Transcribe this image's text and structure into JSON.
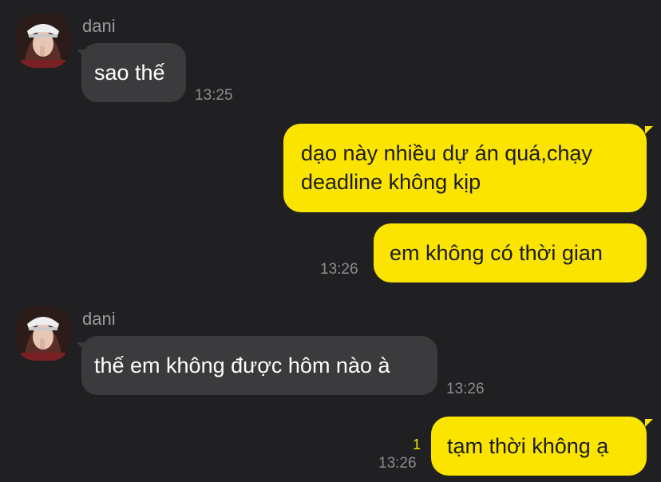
{
  "messages": [
    {
      "sender": "dani",
      "text": "sao thế",
      "time": "13:25"
    },
    {
      "text_line1": "dạo này nhiều dự án quá,chạy",
      "text_line2": "deadline không kịp"
    },
    {
      "text": "em không có thời gian",
      "time": "13:26"
    },
    {
      "sender": "dani",
      "text": "thế em không được hôm nào à",
      "time": "13:26"
    },
    {
      "text": "tạm thời không ạ",
      "time": "13:26",
      "unread": "1"
    }
  ],
  "colors": {
    "background": "#202022",
    "incoming_bubble": "#3b3b3d",
    "outgoing_bubble": "#fbe500",
    "timestamp": "#8c8c8e"
  },
  "icons": [
    "avatar-photo"
  ]
}
